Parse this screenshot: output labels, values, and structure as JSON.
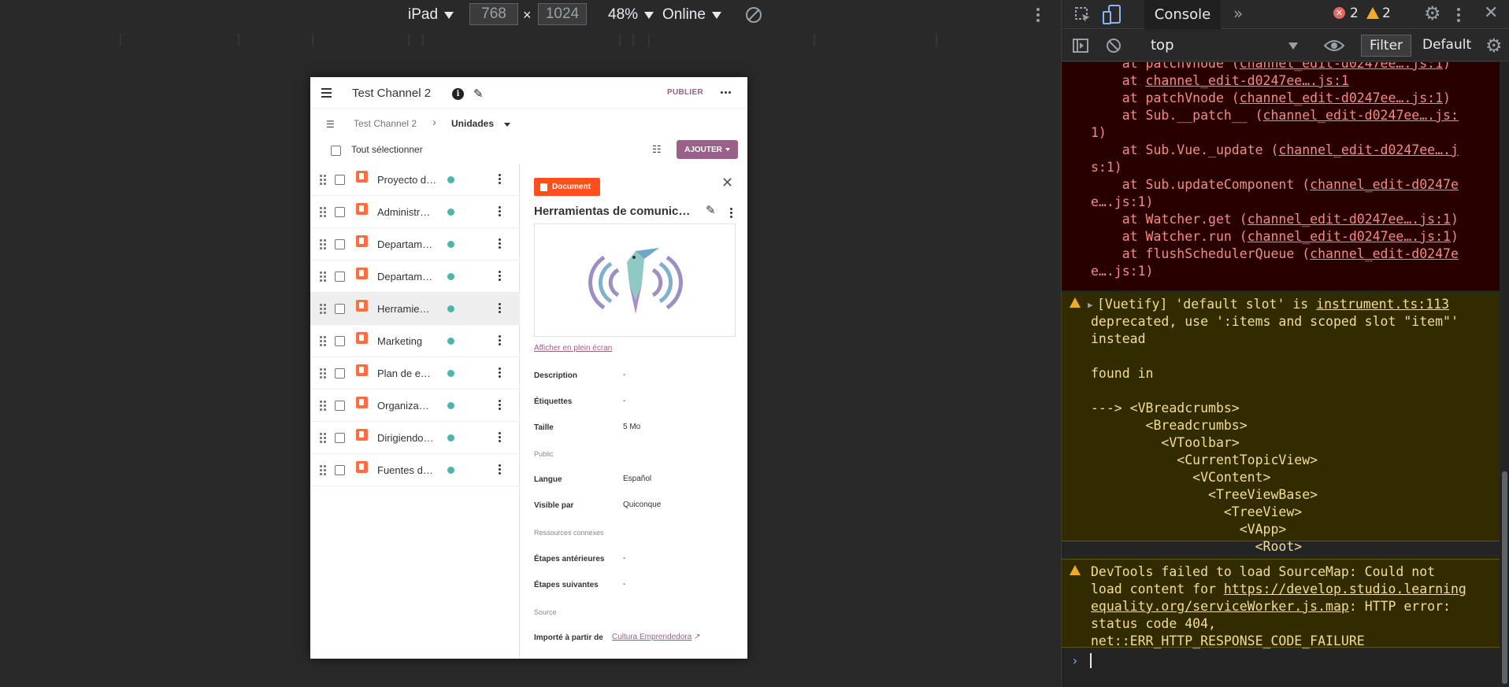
{
  "device_toolbar": {
    "device": "iPad",
    "width": "768",
    "height": "1024",
    "times": "×",
    "zoom": "48%",
    "network": "Online",
    "icons": [
      "rotate-icon",
      "more-icon"
    ]
  },
  "app": {
    "channel_title": "Test Channel 2",
    "publish_label": "PUBLIER",
    "breadcrumb_root": "Test Channel 2",
    "breadcrumb_current": "Unidades",
    "select_all_label": "Tout sélectionner",
    "add_label": "AJOUTER",
    "rows": [
      {
        "title": "Proyecto d…"
      },
      {
        "title": "Administr…"
      },
      {
        "title": "Departam…"
      },
      {
        "title": "Departam…"
      },
      {
        "title": "Herramie…"
      },
      {
        "title": "Marketing"
      },
      {
        "title": "Plan de e…"
      },
      {
        "title": "Organiza…"
      },
      {
        "title": "Dirigiendo…"
      },
      {
        "title": "Fuentes d…"
      }
    ],
    "detail": {
      "kind_badge": "Document",
      "title": "Herramientas de comunic…",
      "fullscreen_link": "Afficher en plein écran",
      "fields": {
        "description": {
          "label": "Description",
          "value": "-"
        },
        "tags": {
          "label": "Étiquettes",
          "value": "-"
        },
        "size": {
          "label": "Taille",
          "value": "5 Mo"
        },
        "public_heading": "Public",
        "language": {
          "label": "Langue",
          "value": "Español"
        },
        "visible": {
          "label": "Visible par",
          "value": "Quiconque"
        },
        "related_heading": "Ressources connexes",
        "previous": {
          "label": "Étapes antérieures",
          "value": "-"
        },
        "next": {
          "label": "Étapes suivantes",
          "value": "-"
        },
        "source_heading": "Source",
        "imported": {
          "label": "Importé à partir de",
          "value": "Cultura Emprendedora"
        }
      }
    }
  },
  "devtools": {
    "tab": "Console",
    "error_count": "2",
    "warning_count": "2",
    "context": "top",
    "filter_label": "Filter",
    "level_label": "Default",
    "error_lines": [
      "    at patchVnode (",
      "    at ",
      "    at patchVnode (",
      "    at Sub.__patch__ (",
      "1)",
      "    at Sub.Vue._update (",
      "s:1)",
      "    at Sub.updateComponent (",
      "e….js:1)",
      "    at Watcher.get (",
      "    at Watcher.run (",
      "    at flushSchedulerQueue (",
      "e….js:1)"
    ],
    "error_links": [
      "channel_edit-d0247ee….js:1",
      "channel_edit-d0247ee….js:1",
      "channel_edit-d0247ee….js:1",
      "channel_edit-d0247ee….js:",
      "channel_edit-d0247ee….j",
      "channel_edit-d0247e",
      "channel_edit-d0247ee….js:1",
      "channel_edit-d0247ee….js:1",
      "channel_edit-d0247e"
    ],
    "warn1": {
      "lead": "[Vuetify] 'default slot' is ",
      "link": "instrument.ts:113",
      "lines": [
        "deprecated, use ':items and scoped slot \"item\"'",
        "instead",
        "found in",
        "---> <VBreadcrumbs>",
        "       <Breadcrumbs>",
        "         <VToolbar>",
        "           <CurrentTopicView>",
        "             <VContent>",
        "               <TreeViewBase>",
        "                 <TreeView>",
        "                   <VApp>",
        "                     <Root>"
      ]
    },
    "warn2": {
      "line1": "DevTools failed to load SourceMap: Could not",
      "line2_lead": "load content for ",
      "link1": "https://develop.studio.learning",
      "link2": "equality.org/serviceWorker.js.map",
      "line3_tail": ": HTTP error:",
      "line4": "status code 404,",
      "line5": "net::ERR_HTTP_RESPONSE_CODE_FAILURE"
    },
    "prompt": "›"
  }
}
